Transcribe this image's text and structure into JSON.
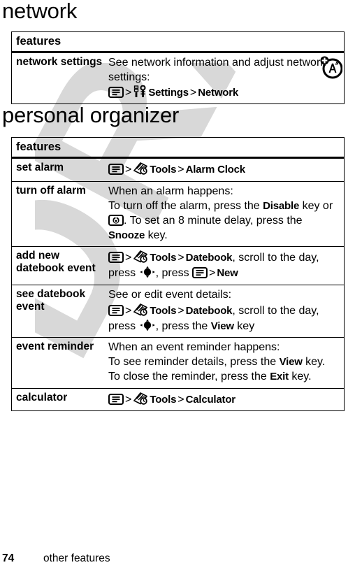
{
  "page": {
    "number": "74",
    "footer_label": "other features",
    "watermark": "DRAFT"
  },
  "sections": [
    {
      "title": "network",
      "table": {
        "header": "features",
        "rows": [
          {
            "feature": "network settings",
            "icon": "network-settings-icon",
            "lines": [
              {
                "type": "text",
                "text": "See network information and adjust network settings:"
              },
              {
                "type": "path",
                "gap": true,
                "parts": [
                  {
                    "kind": "icon",
                    "name": "menu-key-icon"
                  },
                  {
                    "kind": "sep",
                    "text": ">"
                  },
                  {
                    "kind": "icon",
                    "name": "settings-tools-icon"
                  },
                  {
                    "kind": "path",
                    "text": "Settings"
                  },
                  {
                    "kind": "sep",
                    "text": ">"
                  },
                  {
                    "kind": "path",
                    "text": "Network"
                  }
                ]
              }
            ]
          }
        ]
      }
    },
    {
      "title": "personal organizer",
      "table": {
        "header": "features",
        "rows": [
          {
            "feature": "set alarm",
            "lines": [
              {
                "type": "path",
                "parts": [
                  {
                    "kind": "icon",
                    "name": "menu-key-icon"
                  },
                  {
                    "kind": "sep",
                    "text": ">"
                  },
                  {
                    "kind": "icon",
                    "name": "tools-icon"
                  },
                  {
                    "kind": "path",
                    "text": "Tools"
                  },
                  {
                    "kind": "sep",
                    "text": ">"
                  },
                  {
                    "kind": "path",
                    "text": "Alarm Clock"
                  }
                ]
              }
            ]
          },
          {
            "feature": "turn off alarm",
            "lines": [
              {
                "type": "text",
                "text": "When an alarm happens:"
              },
              {
                "type": "mixed",
                "parts": [
                  {
                    "kind": "text",
                    "text": "To turn off the alarm, press the "
                  },
                  {
                    "kind": "key",
                    "text": "Disable"
                  },
                  {
                    "kind": "text",
                    "text": " key or "
                  },
                  {
                    "kind": "icon",
                    "name": "power-key-icon"
                  },
                  {
                    "kind": "text",
                    "text": ". To set an 8 minute delay, press the "
                  },
                  {
                    "kind": "key",
                    "text": "Snooze"
                  },
                  {
                    "kind": "text",
                    "text": " key."
                  }
                ]
              }
            ]
          },
          {
            "feature": "add new datebook event",
            "lines": [
              {
                "type": "mixed",
                "parts": [
                  {
                    "kind": "icon",
                    "name": "menu-key-icon"
                  },
                  {
                    "kind": "sep",
                    "text": ">"
                  },
                  {
                    "kind": "icon",
                    "name": "tools-icon"
                  },
                  {
                    "kind": "path",
                    "text": "Tools"
                  },
                  {
                    "kind": "sep",
                    "text": ">"
                  },
                  {
                    "kind": "path",
                    "text": "Datebook"
                  },
                  {
                    "kind": "text",
                    "text": ", scroll to the day, press "
                  },
                  {
                    "kind": "icon",
                    "name": "navigation-key-icon"
                  },
                  {
                    "kind": "text",
                    "text": ", press "
                  },
                  {
                    "kind": "icon",
                    "name": "menu-key-icon"
                  },
                  {
                    "kind": "sep",
                    "text": ">"
                  },
                  {
                    "kind": "path",
                    "text": "New"
                  }
                ]
              }
            ]
          },
          {
            "feature": "see datebook event",
            "lines": [
              {
                "type": "text",
                "text": "See or edit event details:"
              },
              {
                "type": "mixed",
                "gap": true,
                "parts": [
                  {
                    "kind": "icon",
                    "name": "menu-key-icon"
                  },
                  {
                    "kind": "sep",
                    "text": ">"
                  },
                  {
                    "kind": "icon",
                    "name": "tools-icon"
                  },
                  {
                    "kind": "path",
                    "text": "Tools"
                  },
                  {
                    "kind": "sep",
                    "text": ">"
                  },
                  {
                    "kind": "path",
                    "text": "Datebook"
                  },
                  {
                    "kind": "text",
                    "text": ", scroll to the day, press "
                  },
                  {
                    "kind": "icon",
                    "name": "navigation-key-icon"
                  },
                  {
                    "kind": "text",
                    "text": ", press the "
                  },
                  {
                    "kind": "key",
                    "text": "View"
                  },
                  {
                    "kind": "text",
                    "text": " key"
                  }
                ]
              }
            ]
          },
          {
            "feature": "event reminder",
            "lines": [
              {
                "type": "text",
                "text": "When an event reminder happens:"
              },
              {
                "type": "mixed",
                "parts": [
                  {
                    "kind": "text",
                    "text": "To see reminder details, press the "
                  },
                  {
                    "kind": "key",
                    "text": "View"
                  },
                  {
                    "kind": "text",
                    "text": " key. To close the reminder, press the "
                  },
                  {
                    "kind": "key",
                    "text": "Exit"
                  },
                  {
                    "kind": "text",
                    "text": " key."
                  }
                ]
              }
            ]
          },
          {
            "feature": "calculator",
            "lines": [
              {
                "type": "path",
                "parts": [
                  {
                    "kind": "icon",
                    "name": "menu-key-icon"
                  },
                  {
                    "kind": "sep",
                    "text": ">"
                  },
                  {
                    "kind": "icon",
                    "name": "tools-icon"
                  },
                  {
                    "kind": "path",
                    "text": "Tools"
                  },
                  {
                    "kind": "sep",
                    "text": ">"
                  },
                  {
                    "kind": "path",
                    "text": "Calculator"
                  }
                ]
              }
            ]
          }
        ]
      }
    }
  ],
  "colors": {
    "text": "#000000",
    "background": "#ffffff",
    "watermark": "#d8d8d8"
  }
}
